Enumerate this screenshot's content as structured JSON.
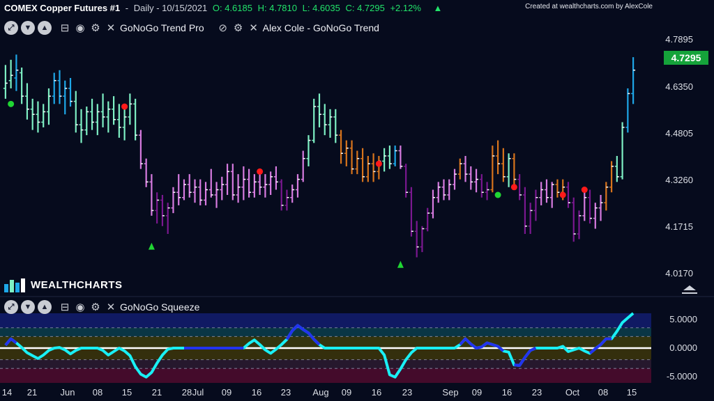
{
  "header": {
    "symbol": "COMEX Copper Futures #1",
    "sep": "-",
    "interval": "Daily - 10/15/2021",
    "open": "O: 4.6185",
    "high": "H: 4.7810",
    "low": "L: 4.6035",
    "close": "C: 4.7295",
    "change": "+2.12%",
    "credit": "Created at wealthcharts.com by AlexCole"
  },
  "indicators": {
    "trend_pro": "GoNoGo Trend Pro",
    "trend_alex": "Alex Cole - GoNoGo Trend",
    "squeeze": "GoNoGo Squeeze"
  },
  "logo_text": "WEALTHCHARTS",
  "price_axis": {
    "ticks": [
      "4.7895",
      "4.6350",
      "4.4805",
      "4.3260",
      "4.1715",
      "4.0170"
    ],
    "last_price": "4.7295"
  },
  "osc_axis": {
    "ticks": [
      "5.0000",
      "0.0000",
      "-5.0000"
    ]
  },
  "date_axis": [
    "14",
    "21",
    "Jun",
    "08",
    "15",
    "21",
    "28",
    "Jul",
    "09",
    "16",
    "23",
    "Aug",
    "09",
    "16",
    "23",
    "Sep",
    "09",
    "16",
    "23",
    "Oct",
    "08",
    "15"
  ],
  "colors": {
    "background": "#060b1d",
    "go_strong": "#1ea7e8",
    "go_weak": "#7ef0c4",
    "nogo_strong": "#7b1890",
    "nogo_weak": "#d77be0",
    "amber": "#d8741c",
    "osc_line": "#19f0f5",
    "osc_blue": "#2233ee",
    "up_change": "#22e36a",
    "marker_red": "#ff1a1a",
    "marker_green": "#20d633"
  },
  "chart_data": {
    "type": "bar",
    "title": "COMEX Copper Futures #1",
    "ylim": [
      3.95,
      4.85
    ],
    "bars": [
      [
        4.66,
        4.75,
        4.62,
        4.68,
        "gow"
      ],
      [
        4.69,
        4.77,
        4.66,
        4.71,
        "gow"
      ],
      [
        4.7,
        4.79,
        4.65,
        4.73,
        "gos"
      ],
      [
        4.72,
        4.74,
        4.6,
        4.63,
        "gow"
      ],
      [
        4.63,
        4.68,
        4.54,
        4.58,
        "gow"
      ],
      [
        4.58,
        4.62,
        4.5,
        4.56,
        "gow"
      ],
      [
        4.56,
        4.61,
        4.49,
        4.53,
        "gow"
      ],
      [
        4.53,
        4.6,
        4.51,
        4.57,
        "gow"
      ],
      [
        4.57,
        4.66,
        4.52,
        4.63,
        "gow"
      ],
      [
        4.63,
        4.72,
        4.6,
        4.69,
        "gos"
      ],
      [
        4.69,
        4.73,
        4.6,
        4.63,
        "gos"
      ],
      [
        4.63,
        4.69,
        4.56,
        4.66,
        "gos"
      ],
      [
        4.66,
        4.7,
        4.59,
        4.61,
        "gos"
      ],
      [
        4.61,
        4.65,
        4.49,
        4.52,
        "gow"
      ],
      [
        4.52,
        4.58,
        4.45,
        4.5,
        "gow"
      ],
      [
        4.5,
        4.59,
        4.48,
        4.57,
        "gow"
      ],
      [
        4.57,
        4.62,
        4.5,
        4.53,
        "gow"
      ],
      [
        4.53,
        4.6,
        4.48,
        4.57,
        "gow"
      ],
      [
        4.57,
        4.64,
        4.51,
        4.55,
        "gow"
      ],
      [
        4.55,
        4.61,
        4.49,
        4.58,
        "gow"
      ],
      [
        4.58,
        4.63,
        4.52,
        4.54,
        "gow"
      ],
      [
        4.54,
        4.6,
        4.47,
        4.51,
        "gow"
      ],
      [
        4.51,
        4.59,
        4.46,
        4.55,
        "gow"
      ],
      [
        4.55,
        4.64,
        4.52,
        4.6,
        "gow"
      ],
      [
        4.6,
        4.62,
        4.46,
        4.48,
        "gow"
      ],
      [
        4.48,
        4.5,
        4.35,
        4.37,
        "nw"
      ],
      [
        4.37,
        4.39,
        4.28,
        4.3,
        "nw"
      ],
      [
        4.3,
        4.33,
        4.17,
        4.19,
        "nw"
      ],
      [
        4.19,
        4.26,
        4.14,
        4.23,
        "ns"
      ],
      [
        4.23,
        4.25,
        4.13,
        4.17,
        "ns"
      ],
      [
        4.17,
        4.22,
        4.1,
        4.2,
        "ns"
      ],
      [
        4.2,
        4.28,
        4.18,
        4.26,
        "nw"
      ],
      [
        4.26,
        4.33,
        4.21,
        4.24,
        "nw"
      ],
      [
        4.24,
        4.31,
        4.23,
        4.29,
        "nw"
      ],
      [
        4.29,
        4.33,
        4.24,
        4.26,
        "nw"
      ],
      [
        4.26,
        4.31,
        4.22,
        4.28,
        "nw"
      ],
      [
        4.28,
        4.31,
        4.21,
        4.23,
        "nw"
      ],
      [
        4.23,
        4.3,
        4.21,
        4.27,
        "nw"
      ],
      [
        4.27,
        4.35,
        4.24,
        4.25,
        "nw"
      ],
      [
        4.25,
        4.3,
        4.2,
        4.27,
        "nw"
      ],
      [
        4.27,
        4.32,
        4.23,
        4.29,
        "nw"
      ],
      [
        4.29,
        4.37,
        4.25,
        4.34,
        "nw"
      ],
      [
        4.34,
        4.37,
        4.23,
        4.25,
        "nw"
      ],
      [
        4.25,
        4.33,
        4.22,
        4.28,
        "nw"
      ],
      [
        4.28,
        4.36,
        4.23,
        4.31,
        "nw"
      ],
      [
        4.31,
        4.35,
        4.24,
        4.26,
        "nw"
      ],
      [
        4.26,
        4.33,
        4.24,
        4.3,
        "nw"
      ],
      [
        4.3,
        4.34,
        4.25,
        4.28,
        "nw"
      ],
      [
        4.28,
        4.33,
        4.24,
        4.29,
        "nw"
      ],
      [
        4.29,
        4.34,
        4.25,
        4.32,
        "nw"
      ],
      [
        4.32,
        4.36,
        4.27,
        4.3,
        "nw"
      ],
      [
        4.3,
        4.31,
        4.19,
        4.21,
        "ns"
      ],
      [
        4.21,
        4.27,
        4.19,
        4.24,
        "ns"
      ],
      [
        4.24,
        4.29,
        4.22,
        4.27,
        "nw"
      ],
      [
        4.27,
        4.33,
        4.24,
        4.31,
        "nw"
      ],
      [
        4.31,
        4.42,
        4.3,
        4.39,
        "nw"
      ],
      [
        4.39,
        4.48,
        4.36,
        4.46,
        "gow"
      ],
      [
        4.46,
        4.62,
        4.45,
        4.59,
        "gow"
      ],
      [
        4.59,
        4.64,
        4.51,
        4.56,
        "gow"
      ],
      [
        4.56,
        4.6,
        4.48,
        4.52,
        "gow"
      ],
      [
        4.52,
        4.58,
        4.47,
        4.55,
        "gow"
      ],
      [
        4.55,
        4.58,
        4.45,
        4.48,
        "gow"
      ],
      [
        4.48,
        4.5,
        4.37,
        4.41,
        "am"
      ],
      [
        4.41,
        4.46,
        4.36,
        4.43,
        "am"
      ],
      [
        4.43,
        4.46,
        4.33,
        4.35,
        "am"
      ],
      [
        4.35,
        4.42,
        4.33,
        4.39,
        "am"
      ],
      [
        4.39,
        4.43,
        4.3,
        4.32,
        "am"
      ],
      [
        4.32,
        4.4,
        4.3,
        4.37,
        "am"
      ],
      [
        4.37,
        4.41,
        4.3,
        4.34,
        "am"
      ],
      [
        4.34,
        4.4,
        4.31,
        4.38,
        "am"
      ],
      [
        4.38,
        4.43,
        4.34,
        4.4,
        "gow"
      ],
      [
        4.4,
        4.44,
        4.35,
        4.37,
        "gow"
      ],
      [
        4.37,
        4.44,
        4.36,
        4.42,
        "gos"
      ],
      [
        4.42,
        4.44,
        4.35,
        4.36,
        "nw"
      ],
      [
        4.36,
        4.37,
        4.24,
        4.26,
        "ns"
      ],
      [
        4.26,
        4.28,
        4.09,
        4.11,
        "ns"
      ],
      [
        4.11,
        4.15,
        4.01,
        4.05,
        "ns"
      ],
      [
        4.05,
        4.13,
        4.03,
        4.12,
        "ns"
      ],
      [
        4.12,
        4.2,
        4.11,
        4.18,
        "ns"
      ],
      [
        4.18,
        4.27,
        4.16,
        4.24,
        "nw"
      ],
      [
        4.24,
        4.3,
        4.22,
        4.28,
        "nw"
      ],
      [
        4.28,
        4.31,
        4.23,
        4.25,
        "nw"
      ],
      [
        4.25,
        4.31,
        4.23,
        4.29,
        "nw"
      ],
      [
        4.29,
        4.35,
        4.27,
        4.33,
        "nw"
      ],
      [
        4.33,
        4.39,
        4.31,
        4.37,
        "am"
      ],
      [
        4.37,
        4.4,
        4.3,
        4.33,
        "nw"
      ],
      [
        4.33,
        4.36,
        4.27,
        4.3,
        "nw"
      ],
      [
        4.3,
        4.35,
        4.26,
        4.31,
        "nw"
      ],
      [
        4.31,
        4.33,
        4.24,
        4.26,
        "ns"
      ],
      [
        4.26,
        4.3,
        4.23,
        4.27,
        "ns"
      ],
      [
        4.27,
        4.44,
        4.26,
        4.4,
        "am"
      ],
      [
        4.4,
        4.46,
        4.33,
        4.37,
        "am"
      ],
      [
        4.37,
        4.43,
        4.3,
        4.32,
        "am"
      ],
      [
        4.32,
        4.41,
        4.28,
        4.39,
        "gow"
      ],
      [
        4.39,
        4.41,
        4.28,
        4.31,
        "am"
      ],
      [
        4.31,
        4.33,
        4.23,
        4.25,
        "ns"
      ],
      [
        4.25,
        4.28,
        4.1,
        4.13,
        "ns"
      ],
      [
        4.13,
        4.22,
        4.1,
        4.19,
        "ns"
      ],
      [
        4.19,
        4.27,
        4.15,
        4.24,
        "ns"
      ],
      [
        4.24,
        4.3,
        4.21,
        4.27,
        "nw"
      ],
      [
        4.27,
        4.31,
        4.22,
        4.24,
        "nw"
      ],
      [
        4.24,
        4.3,
        4.2,
        4.29,
        "nw"
      ],
      [
        4.29,
        4.31,
        4.24,
        4.26,
        "am"
      ],
      [
        4.26,
        4.31,
        4.23,
        4.28,
        "am"
      ],
      [
        4.28,
        4.3,
        4.2,
        4.22,
        "ns"
      ],
      [
        4.22,
        4.24,
        4.07,
        4.1,
        "ns"
      ],
      [
        4.1,
        4.19,
        4.08,
        4.17,
        "ns"
      ],
      [
        4.17,
        4.26,
        4.15,
        4.24,
        "nw"
      ],
      [
        4.24,
        4.27,
        4.14,
        4.16,
        "ns"
      ],
      [
        4.16,
        4.22,
        4.12,
        4.2,
        "nw"
      ],
      [
        4.2,
        4.25,
        4.15,
        4.22,
        "nw"
      ],
      [
        4.22,
        4.3,
        4.19,
        4.28,
        "am"
      ],
      [
        4.28,
        4.38,
        4.26,
        4.36,
        "am"
      ],
      [
        4.36,
        4.4,
        4.3,
        4.32,
        "gow"
      ],
      [
        4.32,
        4.53,
        4.31,
        4.51,
        "gow"
      ],
      [
        4.51,
        4.66,
        4.49,
        4.64,
        "gos"
      ],
      [
        4.64,
        4.78,
        4.6,
        4.73,
        "gos"
      ]
    ],
    "signals": [
      {
        "bar": 1,
        "type": "go_dot",
        "y": 4.6
      },
      {
        "bar": 22,
        "type": "red_dot",
        "y": 4.59
      },
      {
        "bar": 27,
        "type": "green_tri",
        "y": 4.05
      },
      {
        "bar": 47,
        "type": "red_dot",
        "y": 4.34
      },
      {
        "bar": 69,
        "type": "red_dot",
        "y": 4.37
      },
      {
        "bar": 73,
        "type": "green_tri",
        "y": 3.98
      },
      {
        "bar": 91,
        "type": "green_dot",
        "y": 4.25
      },
      {
        "bar": 94,
        "type": "red_dot",
        "y": 4.28
      },
      {
        "bar": 103,
        "type": "red_dot",
        "y": 4.25
      },
      {
        "bar": 107,
        "type": "red_dot",
        "y": 4.27
      }
    ],
    "squeeze": {
      "ylim": [
        -6.0,
        6.0
      ],
      "values": [
        0.5,
        1.6,
        0.9,
        0.1,
        -0.8,
        -1.3,
        -1.8,
        -1.2,
        -0.4,
        0.0,
        0.1,
        -0.3,
        -1.0,
        -0.4,
        0.0,
        0.0,
        0.0,
        0.0,
        -0.4,
        -1.2,
        -0.6,
        0.0,
        -0.5,
        -1.3,
        -3.2,
        -4.5,
        -5.0,
        -4.2,
        -2.6,
        -1.2,
        -0.2,
        0.0,
        0.0,
        0.0,
        0.0,
        0.0,
        0.0,
        0.0,
        0.0,
        0.0,
        0.0,
        0.0,
        0.0,
        0.0,
        0.0,
        0.8,
        1.4,
        0.6,
        -0.3,
        -0.9,
        -0.2,
        0.6,
        1.5,
        3.0,
        3.9,
        3.2,
        2.6,
        1.5,
        0.6,
        0.0,
        0.0,
        0.0,
        0.0,
        0.0,
        0.0,
        0.0,
        0.0,
        0.0,
        0.0,
        0.0,
        -1.2,
        -4.6,
        -5.0,
        -3.6,
        -2.0,
        -0.8,
        0.0,
        0.0,
        0.0,
        0.0,
        0.0,
        0.0,
        0.0,
        0.0,
        0.6,
        1.6,
        0.7,
        0.0,
        0.2,
        0.9,
        0.6,
        0.3,
        -0.5,
        -0.7,
        -2.9,
        -3.0,
        -1.6,
        -0.4,
        0.0,
        0.0,
        0.0,
        0.0,
        0.0,
        0.3,
        -0.6,
        -0.3,
        0.0,
        -0.5,
        -0.9,
        -0.1,
        0.6,
        1.6,
        1.6,
        2.9,
        4.4,
        5.2,
        6.0
      ],
      "blue_segments": [
        [
          0,
          2
        ],
        [
          33,
          44
        ],
        [
          52,
          58
        ],
        [
          84,
          92
        ],
        [
          94,
          98
        ],
        [
          108,
          112
        ]
      ]
    }
  }
}
